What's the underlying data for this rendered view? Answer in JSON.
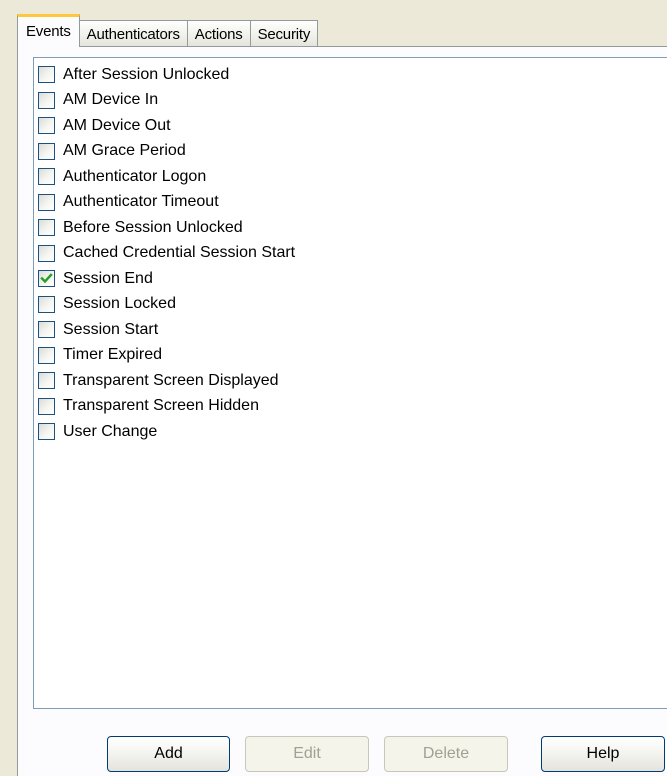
{
  "tabs": [
    {
      "label": "Events",
      "active": true
    },
    {
      "label": "Authenticators",
      "active": false
    },
    {
      "label": "Actions",
      "active": false
    },
    {
      "label": "Security",
      "active": false
    }
  ],
  "events": [
    {
      "label": "After Session Unlocked",
      "checked": false
    },
    {
      "label": "AM Device In",
      "checked": false
    },
    {
      "label": "AM Device Out",
      "checked": false
    },
    {
      "label": "AM Grace Period",
      "checked": false
    },
    {
      "label": "Authenticator Logon",
      "checked": false
    },
    {
      "label": "Authenticator Timeout",
      "checked": false
    },
    {
      "label": "Before Session Unlocked",
      "checked": false
    },
    {
      "label": "Cached Credential Session Start",
      "checked": false
    },
    {
      "label": "Session End",
      "checked": true
    },
    {
      "label": "Session Locked",
      "checked": false
    },
    {
      "label": "Session Start",
      "checked": false
    },
    {
      "label": "Timer Expired",
      "checked": false
    },
    {
      "label": "Transparent Screen Displayed",
      "checked": false
    },
    {
      "label": "Transparent Screen Hidden",
      "checked": false
    },
    {
      "label": "User Change",
      "checked": false
    }
  ],
  "buttons": {
    "add": {
      "label": "Add",
      "enabled": true
    },
    "edit": {
      "label": "Edit",
      "enabled": false
    },
    "delete": {
      "label": "Delete",
      "enabled": false
    },
    "help": {
      "label": "Help",
      "enabled": true
    }
  },
  "colors": {
    "active_tab_accent": "#ffc83c",
    "checkmark": "#21a121",
    "dialog_background": "#ece9d8"
  }
}
